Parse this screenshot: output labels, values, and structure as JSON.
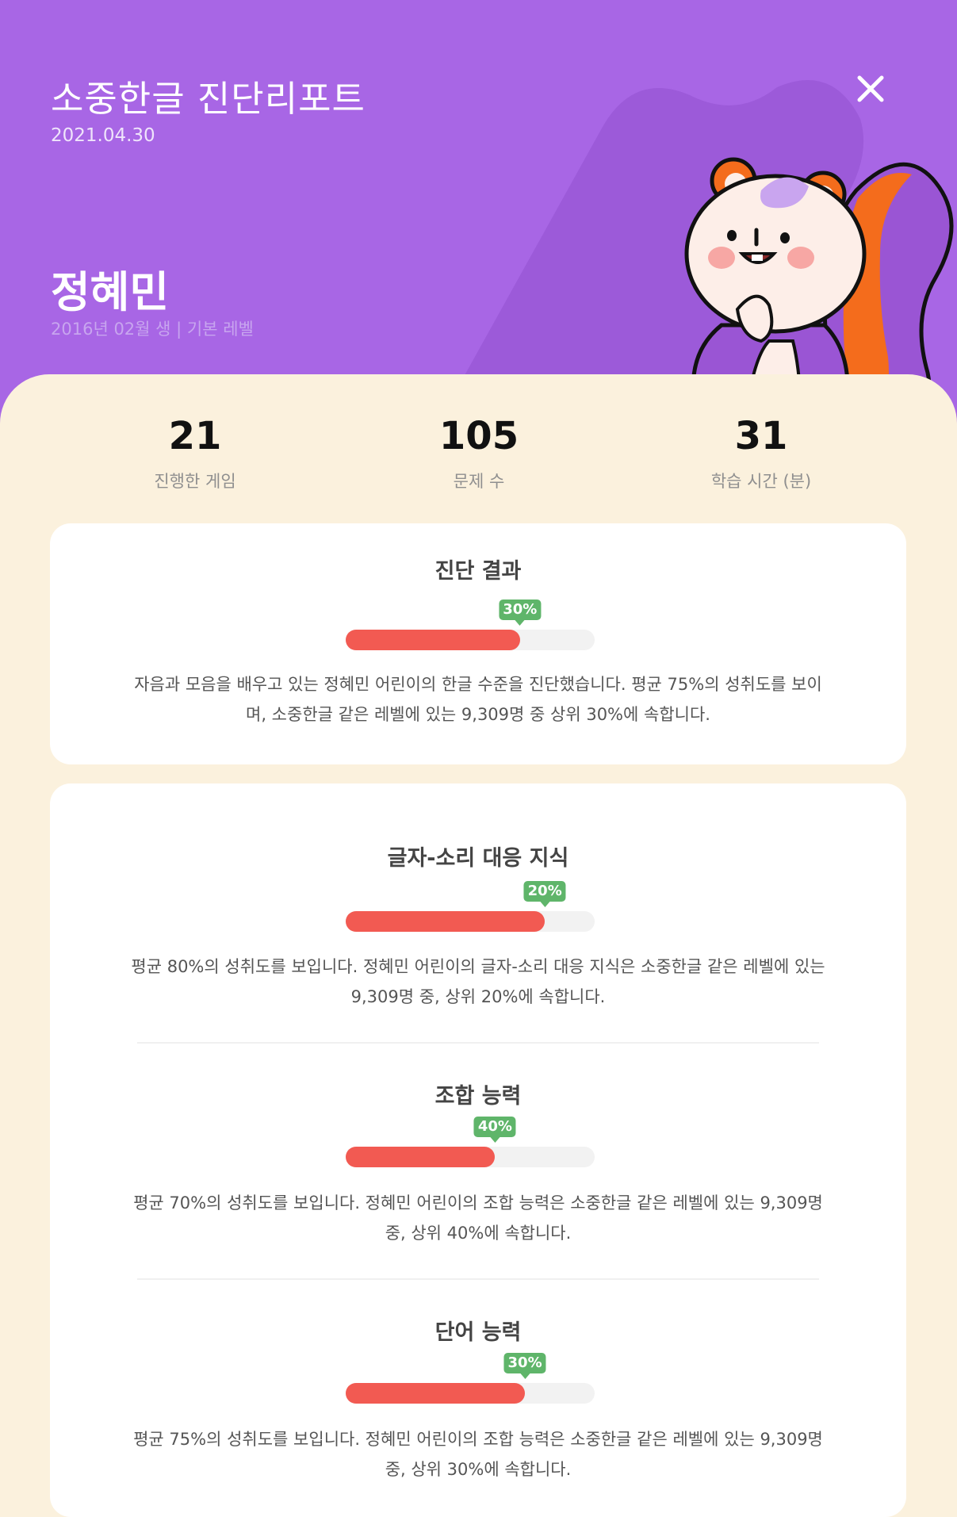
{
  "header": {
    "app_title": "소중한글 진단리포트",
    "date": "2021.04.30",
    "child_name": "정혜민",
    "child_info": "2016년 02월 생 | 기본 레벨"
  },
  "colors": {
    "header_bg": "#a866e5",
    "sheet_bg": "#fbf1dd",
    "bar_fill": "#f25a52",
    "badge": "#5fb56a"
  },
  "stats": [
    {
      "value": "21",
      "label": "진행한 게임"
    },
    {
      "value": "105",
      "label": "문제 수"
    },
    {
      "value": "31",
      "label": "학습 시간 (분)"
    }
  ],
  "summary": {
    "title": "진단 결과",
    "badge": "30%",
    "progress": 0.7,
    "description": "자음과 모음을 배우고 있는 정혜민 어린이의 한글 수준을 진단했습니다. 평균 75%의 성취도를 보이며, 소중한글 같은 레벨에 있는 9,309명 중 상위 30%에 속합니다."
  },
  "details": [
    {
      "title": "글자-소리 대응 지식",
      "badge": "20%",
      "progress": 0.8,
      "description": "평균 80%의 성취도를 보입니다. 정혜민 어린이의 글자-소리 대응 지식은 소중한글 같은 레벨에 있는 9,309명 중, 상위 20%에 속합니다."
    },
    {
      "title": "조합 능력",
      "badge": "40%",
      "progress": 0.6,
      "description": "평균 70%의 성취도를 보입니다. 정혜민 어린이의 조합 능력은 소중한글 같은 레벨에 있는 9,309명 중, 상위 40%에 속합니다."
    },
    {
      "title": "단어 능력",
      "badge": "30%",
      "progress": 0.72,
      "description": "평균 75%의 성취도를 보입니다. 정혜민 어린이의 조합 능력은 소중한글 같은 레벨에 있는 9,309명 중, 상위 30%에 속합니다."
    }
  ],
  "icons": {
    "close": "close-icon",
    "mascot": "squirrel-mascot"
  }
}
